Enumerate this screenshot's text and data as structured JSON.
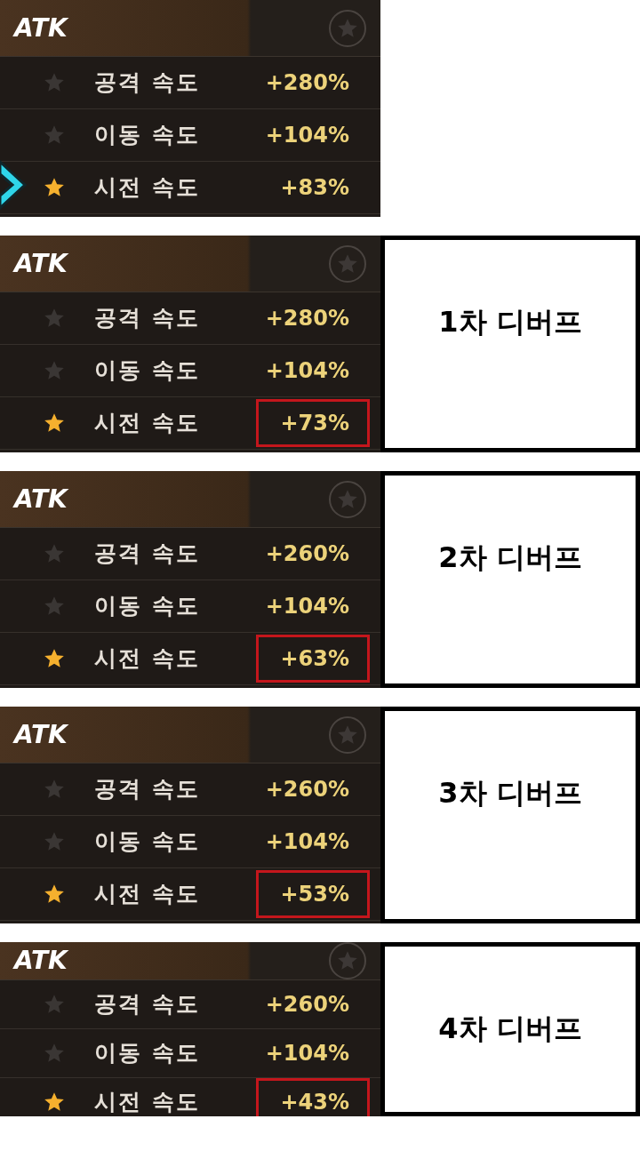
{
  "sections": [
    {
      "pointer": true,
      "panel": {
        "title": "ATK",
        "rows": [
          {
            "label": "공격 속도",
            "value": "+280%",
            "starred": false,
            "highlighted": false
          },
          {
            "label": "이동 속도",
            "value": "+104%",
            "starred": false,
            "highlighted": false
          },
          {
            "label": "시전 속도",
            "value": "+83%",
            "starred": true,
            "highlighted": false
          }
        ]
      }
    },
    {
      "pointer": false,
      "note": "1차 디버프",
      "panel": {
        "title": "ATK",
        "rows": [
          {
            "label": "공격 속도",
            "value": "+280%",
            "starred": false,
            "highlighted": false
          },
          {
            "label": "이동 속도",
            "value": "+104%",
            "starred": false,
            "highlighted": false
          },
          {
            "label": "시전 속도",
            "value": "+73%",
            "starred": true,
            "highlighted": true
          }
        ]
      }
    },
    {
      "pointer": false,
      "note": "2차 디버프",
      "panel": {
        "title": "ATK",
        "rows": [
          {
            "label": "공격 속도",
            "value": "+260%",
            "starred": false,
            "highlighted": false
          },
          {
            "label": "이동 속도",
            "value": "+104%",
            "starred": false,
            "highlighted": false
          },
          {
            "label": "시전 속도",
            "value": "+63%",
            "starred": true,
            "highlighted": true
          }
        ]
      }
    },
    {
      "pointer": false,
      "note": "3차 디버프",
      "panel": {
        "title": "ATK",
        "rows": [
          {
            "label": "공격 속도",
            "value": "+260%",
            "starred": false,
            "highlighted": false
          },
          {
            "label": "이동 속도",
            "value": "+104%",
            "starred": false,
            "highlighted": false
          },
          {
            "label": "시전 속도",
            "value": "+53%",
            "starred": true,
            "highlighted": true
          }
        ]
      }
    },
    {
      "pointer": false,
      "note": "4차 디버프",
      "panel": {
        "title": "ATK",
        "rows": [
          {
            "label": "공격 속도",
            "value": "+260%",
            "starred": false,
            "highlighted": false
          },
          {
            "label": "이동 속도",
            "value": "+104%",
            "starred": false,
            "highlighted": false
          },
          {
            "label": "시전 속도",
            "value": "+43%",
            "starred": true,
            "highlighted": true
          }
        ]
      }
    }
  ]
}
